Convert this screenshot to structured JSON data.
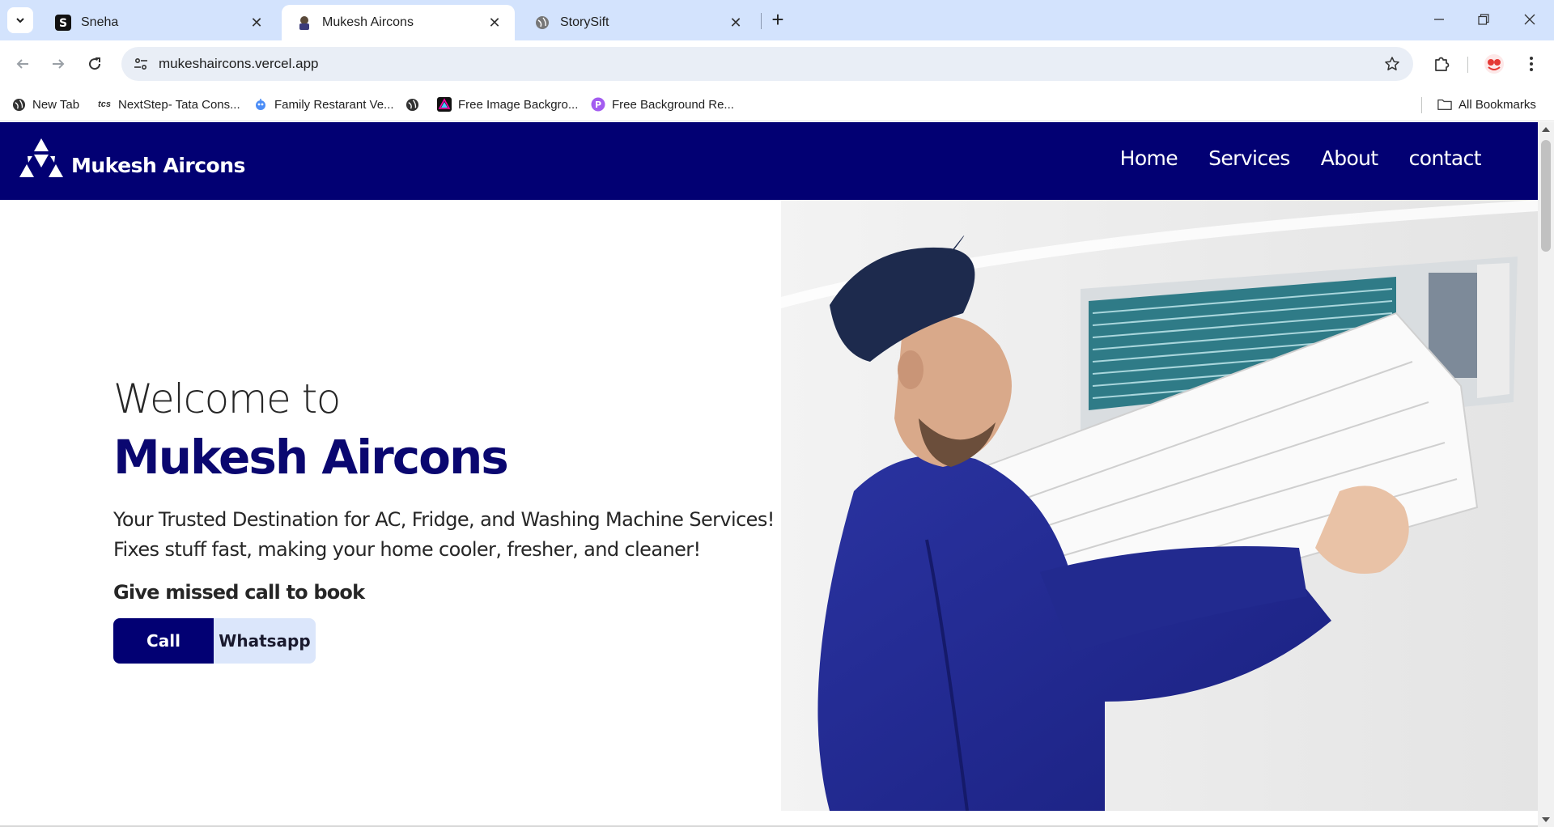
{
  "browser": {
    "tabs": [
      {
        "title": "Sneha",
        "icon": "s-logo-icon",
        "active": false
      },
      {
        "title": "Mukesh Aircons",
        "icon": "aircons-favicon-icon",
        "active": true
      },
      {
        "title": "StorySift",
        "icon": "globe-icon",
        "active": false
      }
    ],
    "url": "mukeshaircons.vercel.app",
    "bookmarks": [
      {
        "label": "New Tab"
      },
      {
        "label": "NextStep- Tata Cons..."
      },
      {
        "label": "Family Restarant Ve..."
      },
      {
        "label": ""
      },
      {
        "label": "Free Image Backgro..."
      },
      {
        "label": "Free Background Re..."
      }
    ],
    "all_bookmarks": "All Bookmarks",
    "tcs_mark": "tcs"
  },
  "site": {
    "brand": "Mukesh Aircons",
    "nav": [
      "Home",
      "Services",
      "About",
      "contact"
    ],
    "hero": {
      "welcome": "Welcome to",
      "title": "Mukesh Aircons",
      "line1": "Your Trusted Destination for AC, Fridge, and Washing Machine Services!",
      "line2": "Fixes stuff fast, making your home cooler, fresher, and cleaner!",
      "missed_call": "Give missed call to book",
      "call_label": "Call",
      "whatsapp_label": "Whatsapp"
    },
    "colors": {
      "primary": "#020073",
      "secondary_button": "#dbe6fb"
    }
  }
}
